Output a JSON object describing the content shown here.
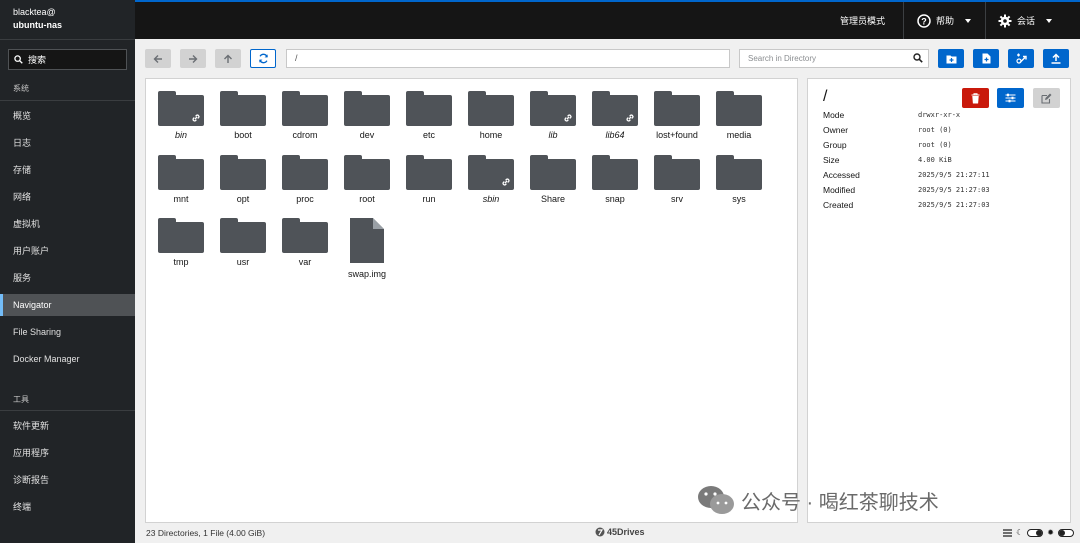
{
  "sidebar": {
    "host_user": "blacktea@",
    "host_name": "ubuntu-nas",
    "search_label": "搜索",
    "section_system": "系统",
    "items_system": [
      "概览",
      "日志",
      "存储",
      "网络",
      "虚拟机",
      "用户账户",
      "服务",
      "Navigator",
      "File Sharing",
      "Docker Manager"
    ],
    "section_tools": "工具",
    "items_tools": [
      "软件更新",
      "应用程序",
      "诊断报告",
      "终端"
    ],
    "active": "Navigator"
  },
  "topbar": {
    "admin_mode": "管理员模式",
    "help": "帮助",
    "session": "会话"
  },
  "toolbar": {
    "path": "/",
    "search_placeholder": "Search in Directory"
  },
  "files": [
    {
      "name": "bin",
      "kind": "folder",
      "link": true
    },
    {
      "name": "boot",
      "kind": "folder",
      "link": false
    },
    {
      "name": "cdrom",
      "kind": "folder",
      "link": false
    },
    {
      "name": "dev",
      "kind": "folder",
      "link": false
    },
    {
      "name": "etc",
      "kind": "folder",
      "link": false
    },
    {
      "name": "home",
      "kind": "folder",
      "link": false
    },
    {
      "name": "lib",
      "kind": "folder",
      "link": true
    },
    {
      "name": "lib64",
      "kind": "folder",
      "link": true
    },
    {
      "name": "lost+found",
      "kind": "folder",
      "link": false
    },
    {
      "name": "media",
      "kind": "folder",
      "link": false
    },
    {
      "name": "mnt",
      "kind": "folder",
      "link": false
    },
    {
      "name": "opt",
      "kind": "folder",
      "link": false
    },
    {
      "name": "proc",
      "kind": "folder",
      "link": false
    },
    {
      "name": "root",
      "kind": "folder",
      "link": false
    },
    {
      "name": "run",
      "kind": "folder",
      "link": false
    },
    {
      "name": "sbin",
      "kind": "folder",
      "link": true
    },
    {
      "name": "Share",
      "kind": "folder",
      "link": false
    },
    {
      "name": "snap",
      "kind": "folder",
      "link": false
    },
    {
      "name": "srv",
      "kind": "folder",
      "link": false
    },
    {
      "name": "sys",
      "kind": "folder",
      "link": false
    },
    {
      "name": "tmp",
      "kind": "folder",
      "link": false
    },
    {
      "name": "usr",
      "kind": "folder",
      "link": false
    },
    {
      "name": "var",
      "kind": "folder",
      "link": false
    },
    {
      "name": "swap.img",
      "kind": "file",
      "link": false
    }
  ],
  "details": {
    "title": "/",
    "props": [
      {
        "key": "Mode",
        "value": "drwxr-xr-x"
      },
      {
        "key": "Owner",
        "value": "root (0)"
      },
      {
        "key": "Group",
        "value": "root (0)"
      },
      {
        "key": "Size",
        "value": "4.00 KiB"
      },
      {
        "key": "Accessed",
        "value": "2025/9/5 21:27:11"
      },
      {
        "key": "Modified",
        "value": "2025/9/5 21:27:03"
      },
      {
        "key": "Created",
        "value": "2025/9/5 21:27:03"
      }
    ]
  },
  "status": {
    "summary": "23 Directories, 1 File (4.00 GiB)",
    "brand": "45Drives"
  },
  "watermark": "公众号 · 喝红茶聊技术",
  "colors": {
    "accent": "#0066cc",
    "danger": "#c9190b",
    "sidebar_bg": "#212427",
    "folder": "#4f5358"
  }
}
